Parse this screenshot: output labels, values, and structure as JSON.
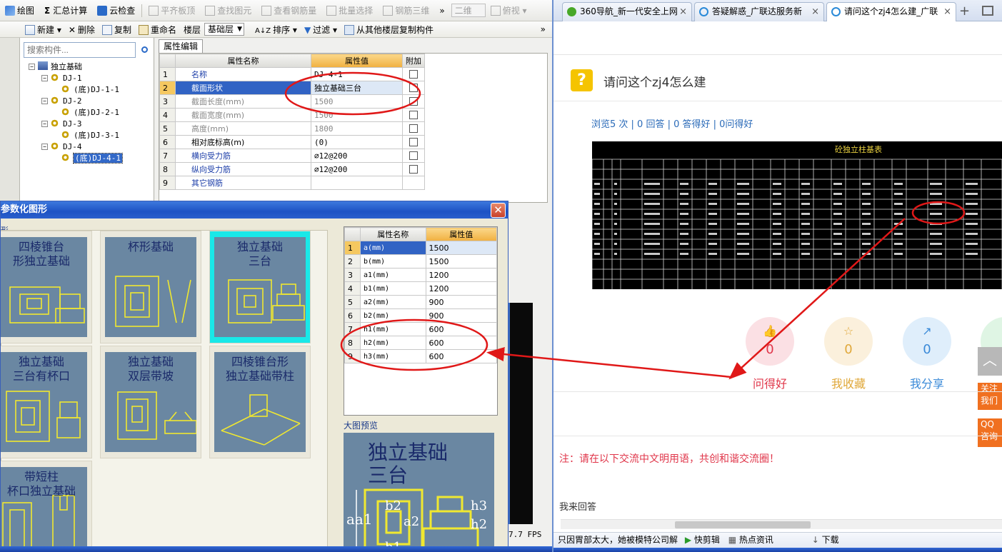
{
  "left_toolbar1": {
    "items": [
      "绘图",
      "汇总计算",
      "云检查",
      "平齐板顶",
      "查找图元",
      "查看钢筋量",
      "批量选择",
      "钢筋三维"
    ],
    "view_2d": "二维",
    "view_top": "俯视",
    "more": "»"
  },
  "left_toolbar2": {
    "new": "新建",
    "delete": "删除",
    "copy": "复制",
    "rename": "重命名",
    "floor_label": "楼层",
    "floor_value": "基础层",
    "sort": "排序",
    "filter": "过滤",
    "copy_from_floor": "从其他楼层复制构件",
    "more": "»"
  },
  "tree": {
    "search_placeholder": "搜索构件...",
    "nodes": [
      {
        "label": "独立基础",
        "level": 0,
        "expander": "−"
      },
      {
        "label": "DJ-1",
        "level": 1,
        "expander": "−"
      },
      {
        "label": "(底)DJ-1-1",
        "level": 2,
        "expander": ""
      },
      {
        "label": "DJ-2",
        "level": 1,
        "expander": "−"
      },
      {
        "label": "(底)DJ-2-1",
        "level": 2,
        "expander": ""
      },
      {
        "label": "DJ-3",
        "level": 1,
        "expander": "−"
      },
      {
        "label": "(底)DJ-3-1",
        "level": 2,
        "expander": ""
      },
      {
        "label": "DJ-4",
        "level": 1,
        "expander": "−"
      },
      {
        "label": "(底)DJ-4-1",
        "level": 2,
        "expander": "",
        "selected": true
      }
    ]
  },
  "attr_tab": "属性编辑",
  "attr_grid": {
    "headers": [
      "属性名称",
      "属性值",
      "附加"
    ],
    "rows": [
      {
        "n": "1",
        "name": "名称",
        "value": "DJ-4-1",
        "check": false,
        "style": "blue"
      },
      {
        "n": "2",
        "name": "截面形状",
        "value": "独立基础三台",
        "check": true,
        "style": "blue",
        "highlight": true
      },
      {
        "n": "3",
        "name": "截面长度(mm)",
        "value": "1500",
        "check": true,
        "style": "gray"
      },
      {
        "n": "4",
        "name": "截面宽度(mm)",
        "value": "1500",
        "check": true,
        "style": "gray"
      },
      {
        "n": "5",
        "name": "高度(mm)",
        "value": "1800",
        "check": true,
        "style": "gray"
      },
      {
        "n": "6",
        "name": "相对底标高(m)",
        "value": "(0)",
        "check": true,
        "style": "normal"
      },
      {
        "n": "7",
        "name": "横向受力筋",
        "value": "⌀12@200",
        "check": true,
        "style": "blue"
      },
      {
        "n": "8",
        "name": "纵向受力筋",
        "value": "⌀12@200",
        "check": true,
        "style": "blue"
      },
      {
        "n": "9",
        "name": "其它钢筋",
        "value": "",
        "check": null,
        "style": "blue"
      }
    ]
  },
  "dialog": {
    "title": "参数化图形",
    "group_label": "形",
    "close": "✕",
    "shapes": [
      {
        "title": "四棱锥台\n形独立基础"
      },
      {
        "title": "杯形基础"
      },
      {
        "title": "独立基础\n三台",
        "selected": true
      },
      {
        "title": "独立基础\n三台有杯口"
      },
      {
        "title": "独立基础\n双层带坡"
      },
      {
        "title": "四棱锥台形\n独立基础带柱"
      },
      {
        "title": "带短柱\n杯口独立基础"
      }
    ],
    "params": {
      "headers": [
        "属性名称",
        "属性值"
      ],
      "rows": [
        {
          "n": "1",
          "name": "a(mm)",
          "value": "1500"
        },
        {
          "n": "2",
          "name": "b(mm)",
          "value": "1500"
        },
        {
          "n": "3",
          "name": "a1(mm)",
          "value": "1200"
        },
        {
          "n": "4",
          "name": "b1(mm)",
          "value": "1200"
        },
        {
          "n": "5",
          "name": "a2(mm)",
          "value": "900"
        },
        {
          "n": "6",
          "name": "b2(mm)",
          "value": "900"
        },
        {
          "n": "7",
          "name": "h1(mm)",
          "value": "600"
        },
        {
          "n": "8",
          "name": "h2(mm)",
          "value": "600"
        },
        {
          "n": "9",
          "name": "h3(mm)",
          "value": "600"
        }
      ]
    },
    "preview_label": "大图预览",
    "preview_title": "独立基础\n三台"
  },
  "fps": "7.7 FPS",
  "browser": {
    "tabs": [
      {
        "label": "360导航_新一代安全上网",
        "close": "×"
      },
      {
        "label": "答疑解惑_广联达服务新",
        "close": "×"
      },
      {
        "label": "请问这个zj4怎么建_广联",
        "close": "×",
        "active": true
      }
    ],
    "new_tab": "+",
    "question_icon": "?",
    "question_title": "请问这个zj4怎么建",
    "stats": "浏览5 次 | 0 回答 | 0 答得好 | 0问得好",
    "image_title": "砼独立柱基表",
    "actions": [
      {
        "label": "问得好",
        "count": "0",
        "color": "#e0364a",
        "bg": "#fbe0e4"
      },
      {
        "label": "我收藏",
        "count": "0",
        "color": "#e0a83a",
        "bg": "#fbf0dc"
      },
      {
        "label": "我分享",
        "count": "0",
        "color": "#3a8ad8",
        "bg": "#dfeefb"
      }
    ],
    "side_follow": "关注\n我们",
    "side_qq": "QQ\n咨询",
    "notice": "注：请在以下交流中文明用语，共创和谐交流圈！",
    "answer_label": "我来回答",
    "status_news": "只因胃部太大，她被模特公司解",
    "status_items": [
      "快剪辑",
      "热点资讯",
      "下载"
    ]
  },
  "colors": {
    "annotation_red": "#e01818",
    "selection_blue": "#3163c4",
    "header_orange": "#f0b040",
    "blueprint_bg": "#6a87a2",
    "cyan_select": "#19e8e8"
  }
}
